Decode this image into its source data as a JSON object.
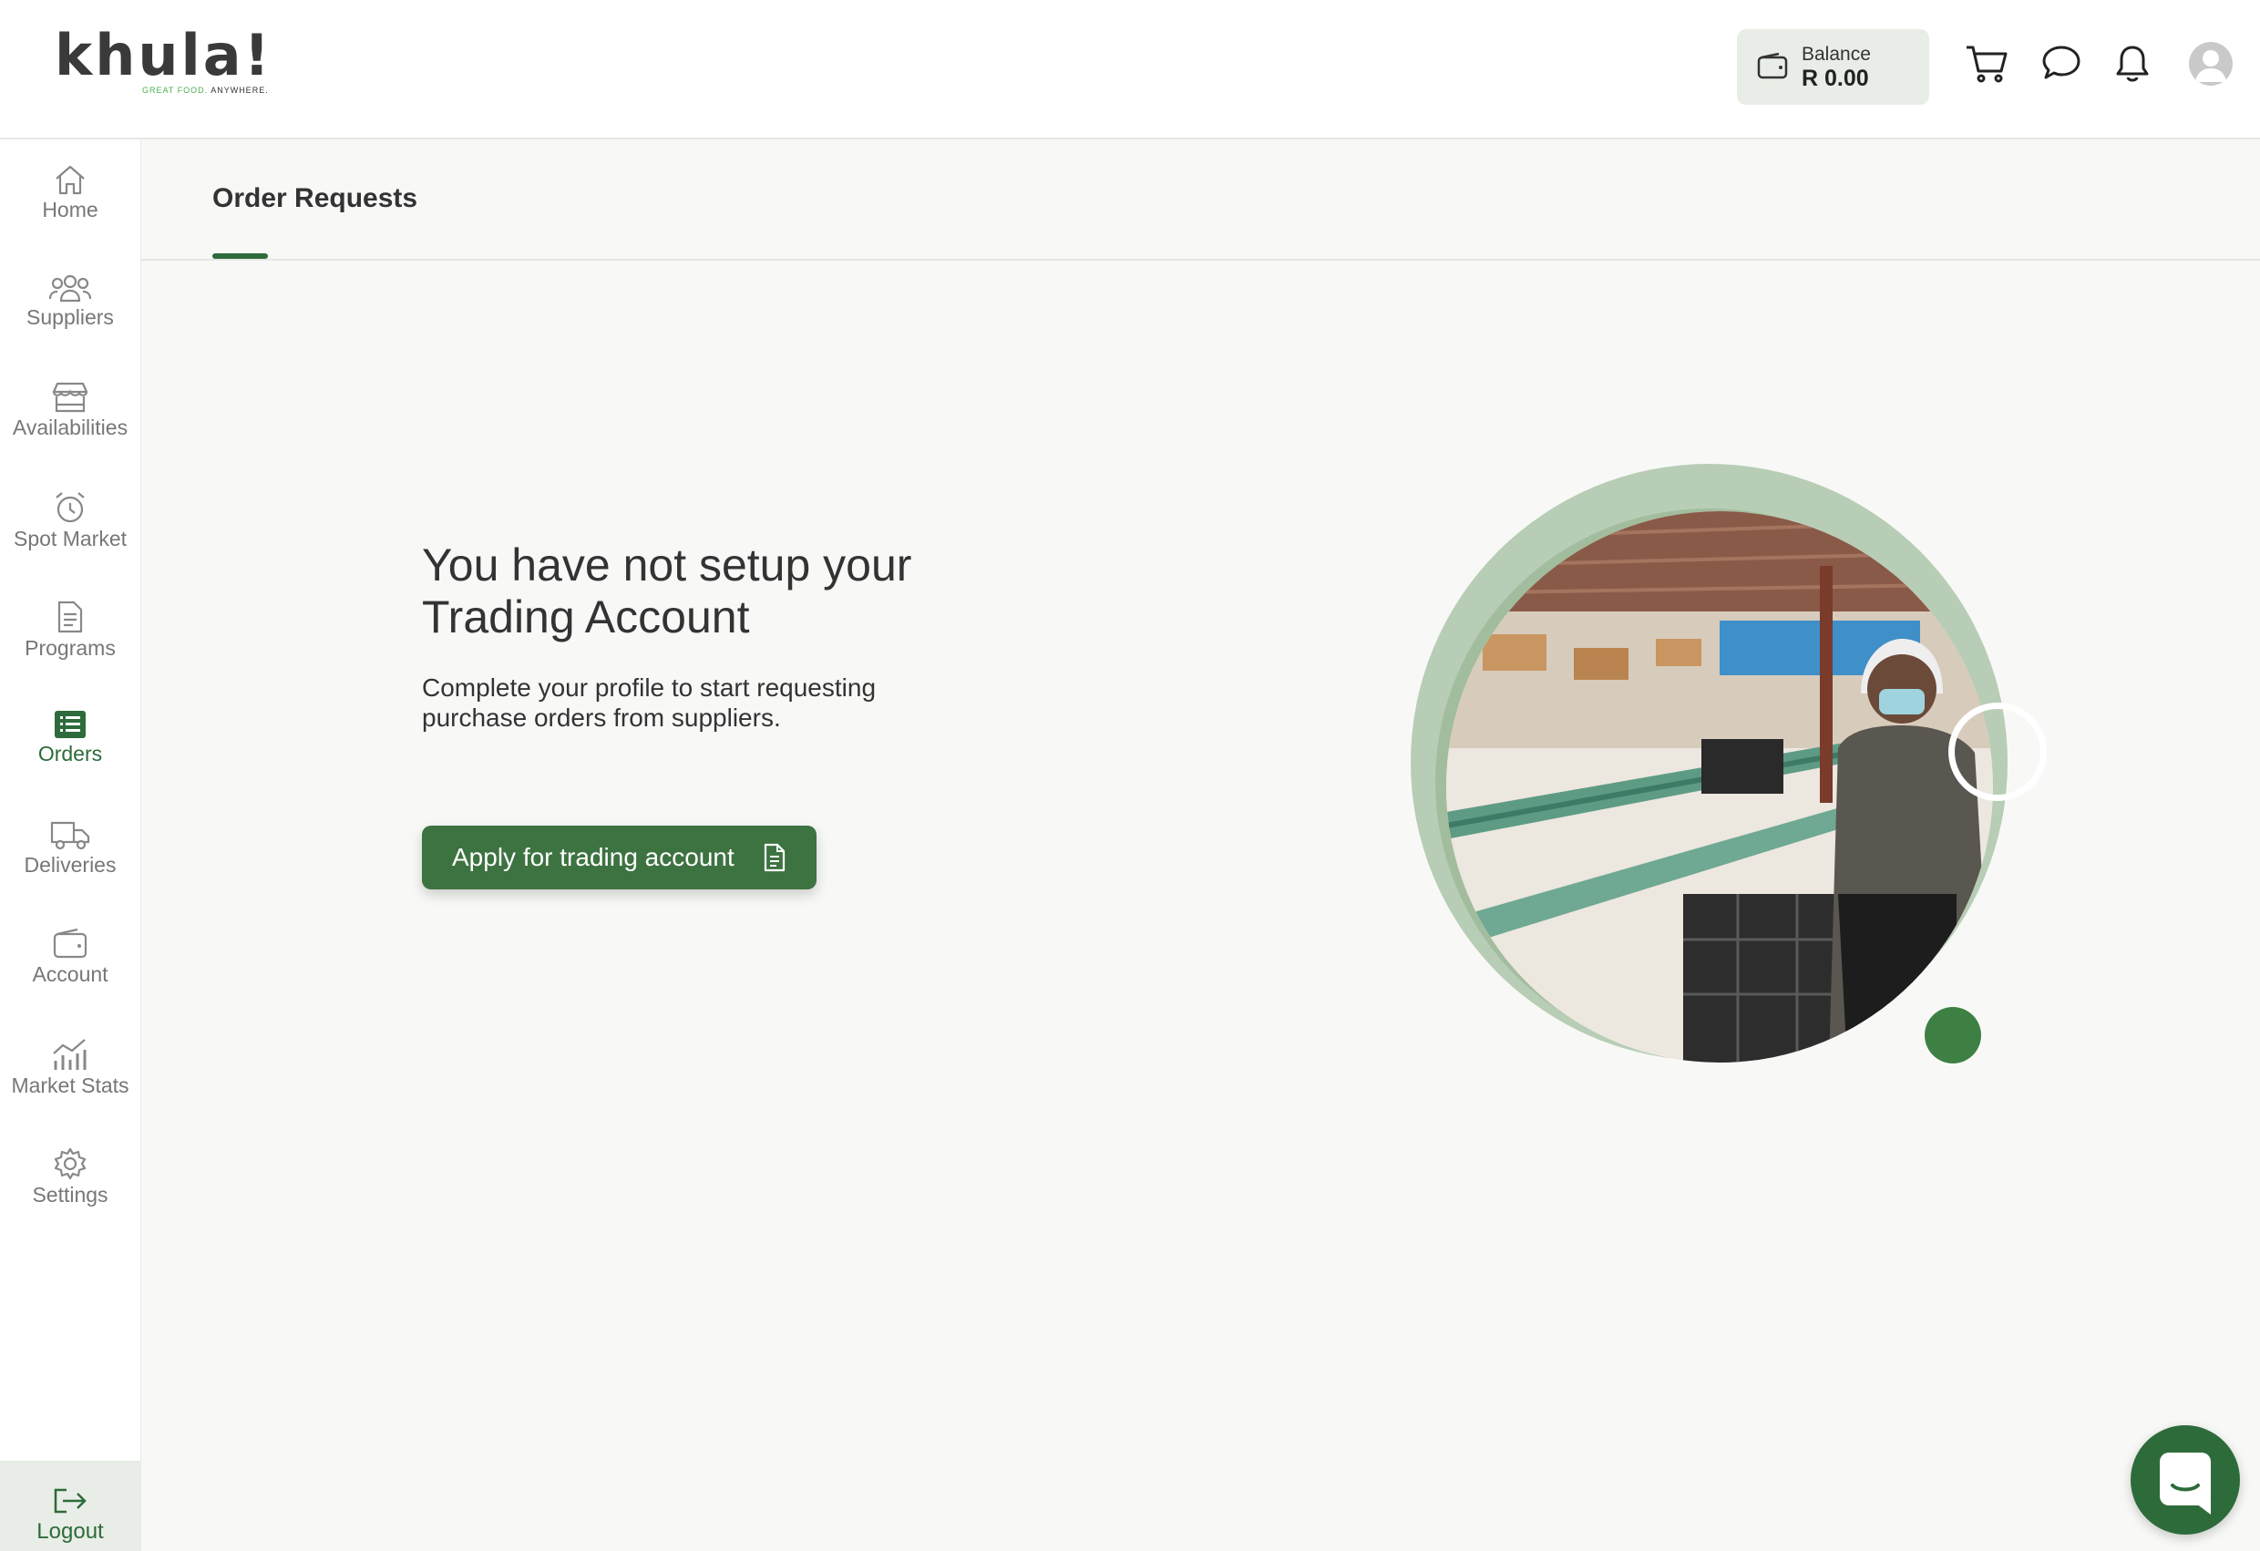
{
  "brand": {
    "name": "khula!",
    "tagline_green": "GREAT FOOD.",
    "tagline_dark": "ANYWHERE."
  },
  "header": {
    "balance_label": "Balance",
    "balance_value": "R 0.00",
    "icons": [
      "wallet-icon",
      "cart-icon",
      "chat-icon",
      "bell-icon",
      "avatar"
    ]
  },
  "sidebar": {
    "items": [
      {
        "label": "Home",
        "icon": "home-icon"
      },
      {
        "label": "Suppliers",
        "icon": "users-icon"
      },
      {
        "label": "Availabilities",
        "icon": "store-icon"
      },
      {
        "label": "Spot Market",
        "icon": "alarm-clock-icon"
      },
      {
        "label": "Programs",
        "icon": "document-icon"
      },
      {
        "label": "Orders",
        "icon": "list-icon",
        "active": true
      },
      {
        "label": "Deliveries",
        "icon": "truck-icon"
      },
      {
        "label": "Account",
        "icon": "wallet-icon"
      },
      {
        "label": "Market Stats",
        "icon": "chart-icon"
      },
      {
        "label": "Settings",
        "icon": "gear-icon"
      }
    ],
    "logout_label": "Logout"
  },
  "page": {
    "title": "Order Requests"
  },
  "empty_state": {
    "headline": "You have not setup your Trading Account",
    "description": "Complete your profile to start requesting purchase orders from suppliers.",
    "button_label": "Apply for trading account"
  },
  "colors": {
    "accent": "#3d7341",
    "active_nav": "#2e6b3a",
    "balance_bg": "#e9ede7",
    "page_bg": "#f8f9f7"
  }
}
